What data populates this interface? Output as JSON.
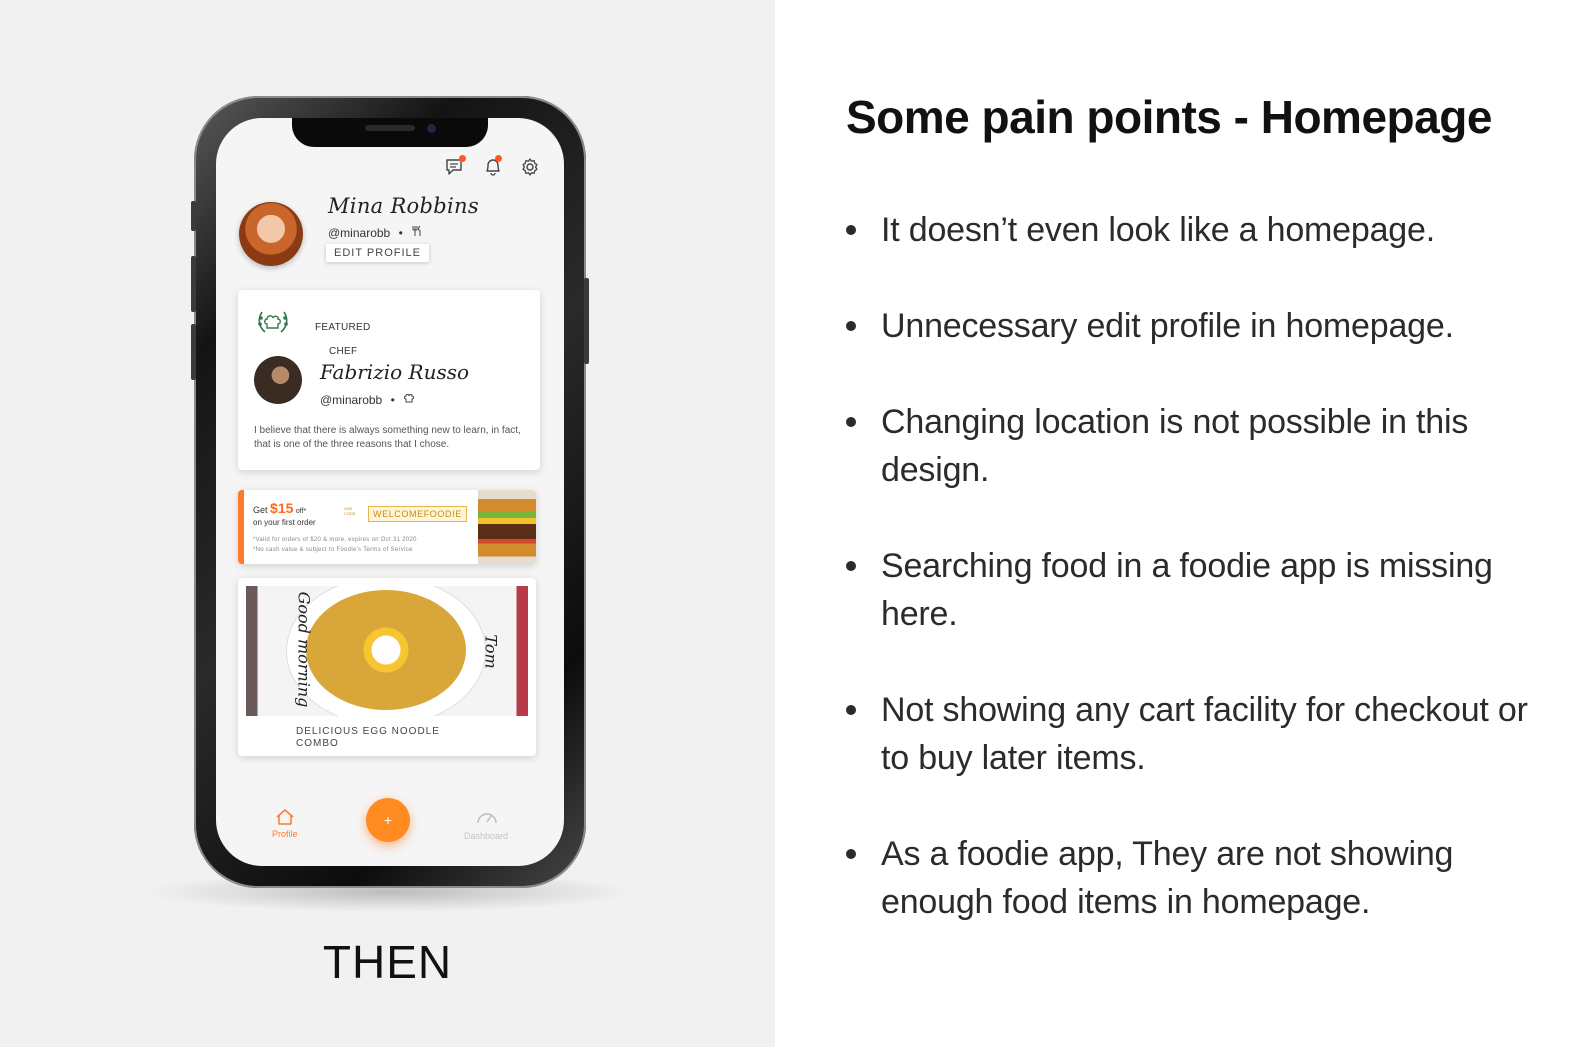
{
  "slide": {
    "title": "Some pain points - Homepage",
    "caption": "THEN",
    "bullets": [
      "It doesn’t even look like a homepage.",
      "Unnecessary edit profile in homepage.",
      "Changing location is not possible in this design.",
      "Searching food in a foodie app is missing here.",
      "Not showing any cart facility for checkout or to buy later items.",
      "As a foodie app, They are not showing enough food items in homepage."
    ]
  },
  "app": {
    "accent_color": "#ff7a2d",
    "top_icons": [
      "chat-icon",
      "bell-icon",
      "gear-icon"
    ],
    "profile": {
      "name": "Mina Robbins",
      "handle": "@minarobb",
      "role_icon": "fork-knife-icon",
      "edit_label": "EDIT PROFILE"
    },
    "featured": {
      "badge_icon": "chef-hat-laurel-icon",
      "label": "FEATURED",
      "role": "CHEF",
      "name": "Fabrizio Russo",
      "handle": "@minarobb",
      "role_icon": "chef-hat-icon",
      "quote": "I believe that there is always something new to learn, in fact, that is one of the three reasons that I chose."
    },
    "promo": {
      "get": "Get",
      "amount": "$15",
      "off": "off*",
      "subtitle": "on your first order",
      "use_code": "USE CODE",
      "code": "WELCOMEFOODIE",
      "fine1": "*Valid for orders of $20 & more, expires on Oct 31 2020",
      "fine2": "*No cash value & subject to Foodie's Terms of Service"
    },
    "food": {
      "plate_text_left": "Good morning",
      "plate_text_right": "Tom",
      "caption": "DELICIOUS EGG NOODLE COMBO"
    },
    "nav": {
      "profile_label": "Profile",
      "add_label": "+",
      "dashboard_label": "Dashboard"
    }
  }
}
